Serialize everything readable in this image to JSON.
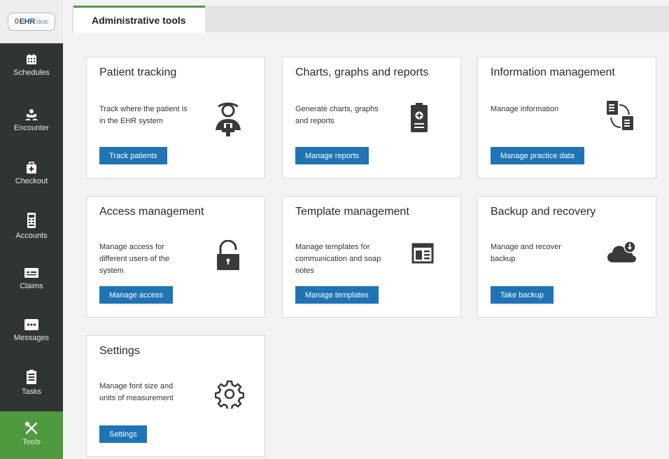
{
  "logo": {
    "prefix": "0",
    "brand": "EHR",
    "suffix": "clinic"
  },
  "sidebar": {
    "items": [
      {
        "label": "Schedules",
        "icon": "calendar-icon"
      },
      {
        "label": "Encounter",
        "icon": "people-icon"
      },
      {
        "label": "Checkout",
        "icon": "medical-bag-icon"
      },
      {
        "label": "Accounts",
        "icon": "document-icon"
      },
      {
        "label": "Claims",
        "icon": "card-icon"
      },
      {
        "label": "Messages",
        "icon": "chat-icon"
      },
      {
        "label": "Tasks",
        "icon": "clipboard-icon"
      },
      {
        "label": "Tools",
        "icon": "tools-icon",
        "active": true
      }
    ]
  },
  "tab": {
    "label": "Administrative tools"
  },
  "cards": [
    {
      "title": "Patient tracking",
      "desc_line1": "Track where the patient is",
      "desc_line2": "in the EHR system",
      "button": "Track patients",
      "icon": "patient-add-icon"
    },
    {
      "title": "Charts, graphs and reports",
      "desc_line1": "Generate charts, graphs",
      "desc_line2": "and reports",
      "button": "Manage reports",
      "icon": "clipboard-report-icon"
    },
    {
      "title": "Information management",
      "desc_line1": "Manage information",
      "button": "Manage practice data",
      "icon": "documents-icon"
    },
    {
      "title": "Access management",
      "desc_line1": "Manage access for",
      "desc_line2": "different users of the",
      "desc_line3": "system",
      "button": "Manage access",
      "icon": "lock-icon"
    },
    {
      "title": "Template management",
      "desc_line1": "Manage templates for",
      "desc_line2": "communication and soap",
      "desc_line3": "notes",
      "button": "Manage templates",
      "icon": "template-icon"
    },
    {
      "title": "Backup and recovery",
      "desc_line1": "Manage and recover",
      "desc_line2": "backup",
      "button": "Take backup",
      "icon": "cloud-download-icon"
    },
    {
      "title": "Settings",
      "desc_line1": "Manage font size and",
      "desc_line2": "units of measurement",
      "button": "Settings",
      "icon": "gear-icon"
    }
  ],
  "colors": {
    "accent": "#4f9a3f",
    "button": "#1f74b5",
    "sidebar": "#2f3437"
  }
}
